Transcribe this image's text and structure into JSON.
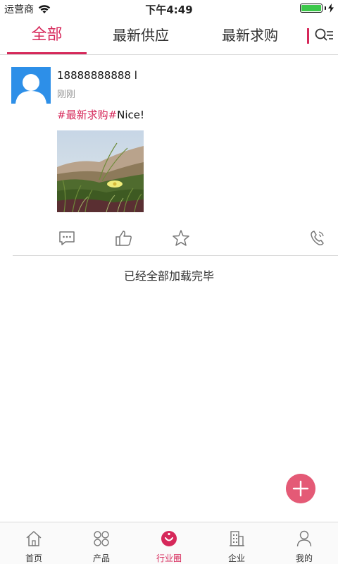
{
  "status_bar": {
    "carrier": "运营商",
    "time": "下午4:49",
    "battery_level": 1.0
  },
  "tabs": [
    {
      "label": "全部",
      "active": true
    },
    {
      "label": "最新供应",
      "active": false
    },
    {
      "label": "最新求购",
      "active": false
    }
  ],
  "post": {
    "username": "18888888888 l",
    "time": "刚刚",
    "hashtag": "#最新求购#",
    "text": "Nice!",
    "actions": [
      "comment-icon",
      "thumbs-up-icon",
      "star-icon",
      "phone-icon"
    ]
  },
  "feed": {
    "end_text": "已经全部加载完毕"
  },
  "bottom_nav": [
    {
      "label": "首页",
      "icon": "home-icon",
      "active": false
    },
    {
      "label": "产品",
      "icon": "grid-icon",
      "active": false
    },
    {
      "label": "行业圈",
      "icon": "smile-circle-icon",
      "active": true
    },
    {
      "label": "企业",
      "icon": "building-icon",
      "active": false
    },
    {
      "label": "我的",
      "icon": "user-icon",
      "active": false
    }
  ],
  "colors": {
    "accent": "#d6285a",
    "fab": "#e45a76",
    "avatar_bg": "#2d8fe8"
  }
}
